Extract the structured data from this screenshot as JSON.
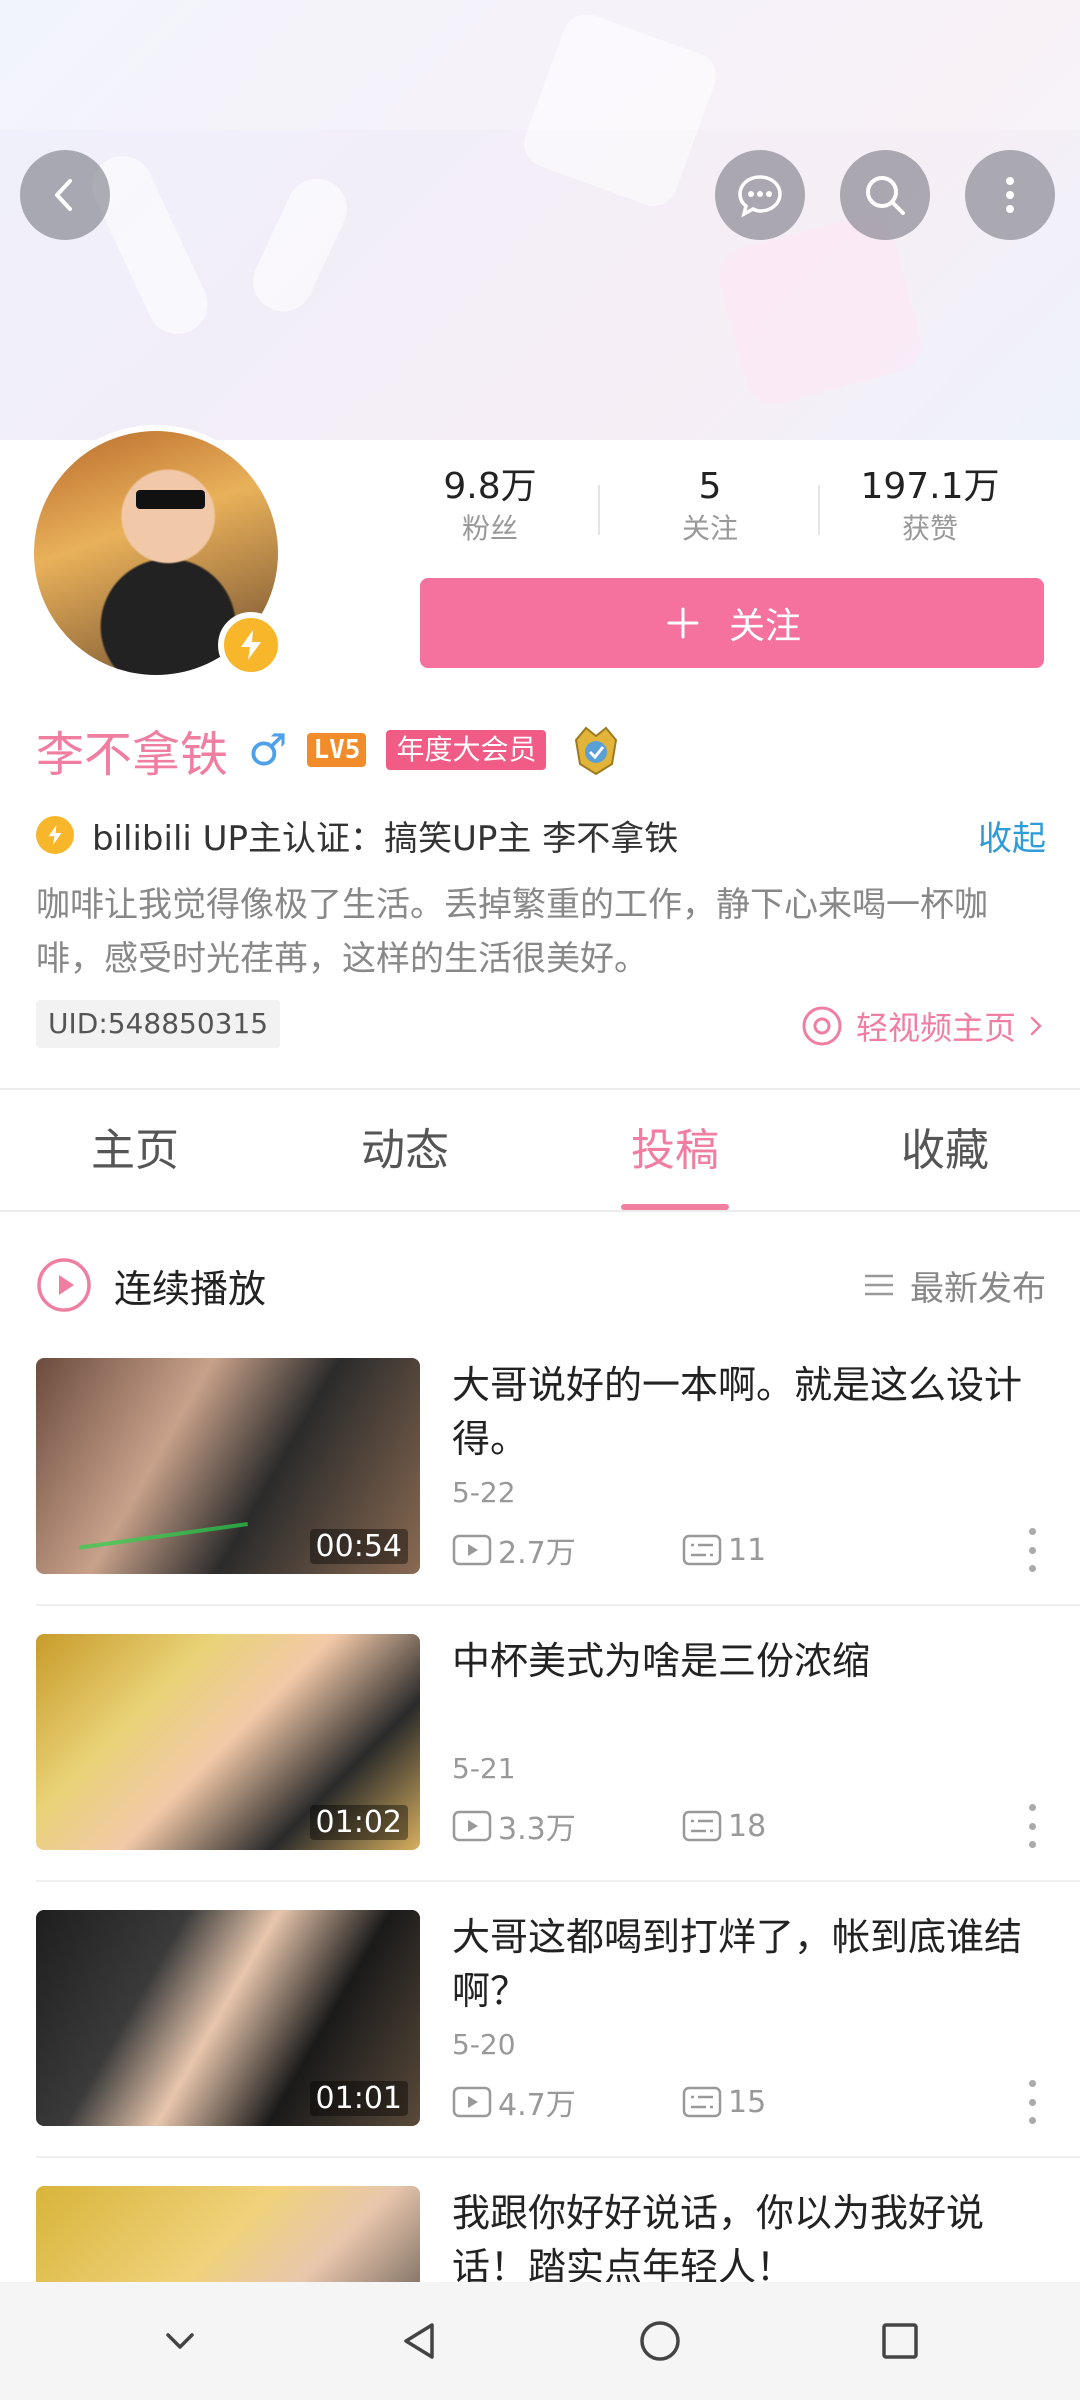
{
  "header": {
    "back_icon": "back-arrow-icon",
    "chat_icon": "chat-bubble-icon",
    "search_icon": "search-icon",
    "more_icon": "more-vertical-icon"
  },
  "profile": {
    "name": "李不拿铁",
    "gender_symbol": "♂",
    "level": "LV5",
    "vip_badge": "年度大会员",
    "stats": [
      {
        "value": "9.8万",
        "label": "粉丝"
      },
      {
        "value": "5",
        "label": "关注"
      },
      {
        "value": "197.1万",
        "label": "获赞"
      }
    ],
    "follow_label": "关注",
    "certification": "bilibili UP主认证：搞笑UP主 李不拿铁",
    "collapse_label": "收起",
    "bio": "咖啡让我觉得像极了生活。丢掉繁重的工作，静下心来喝一杯咖啡，感受时光荏苒，这样的生活很美好。",
    "uid": "UID:548850315",
    "light_video_link": "轻视频主页"
  },
  "tabs": [
    {
      "label": "主页",
      "active": false
    },
    {
      "label": "动态",
      "active": false
    },
    {
      "label": "投稿",
      "active": true
    },
    {
      "label": "收藏",
      "active": false
    }
  ],
  "playlist": {
    "title": "连续播放",
    "sort_label": "最新发布"
  },
  "videos": [
    {
      "title": "大哥说好的一本啊。就是这么设计得。",
      "date": "5-22",
      "views": "2.7万",
      "comments": "11",
      "duration": "00:54"
    },
    {
      "title": "中杯美式为啥是三份浓缩",
      "date": "5-21",
      "views": "3.3万",
      "comments": "18",
      "duration": "01:02"
    },
    {
      "title": "大哥这都喝到打烊了，帐到底谁结啊？",
      "date": "5-20",
      "views": "4.7万",
      "comments": "15",
      "duration": "01:01"
    },
    {
      "title": "我跟你好好说话，你以为我好说话！踏实点年轻人！",
      "date": "",
      "views": "",
      "comments": "",
      "duration": ""
    }
  ],
  "colors": {
    "accent": "#f07ea0",
    "follow_button": "#f5729e",
    "link_blue": "#2f9bd8",
    "badge_yellow": "#f8b62b"
  }
}
